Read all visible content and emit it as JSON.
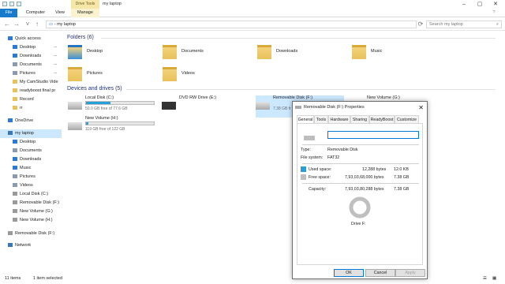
{
  "window": {
    "title": "my laptop",
    "contextual_tab": "Drive Tools"
  },
  "ribbon": {
    "tabs": [
      "File",
      "Computer",
      "View",
      "Manage"
    ]
  },
  "address": {
    "path": "my laptop",
    "search_placeholder": "Search my laptop"
  },
  "nav": {
    "items": [
      {
        "label": "Quick access",
        "icon": "star-icon"
      },
      {
        "label": "Desktop",
        "icon": "desktop-icon"
      },
      {
        "label": "Downloads",
        "icon": "download-icon"
      },
      {
        "label": "Documents",
        "icon": "documents-icon"
      },
      {
        "label": "Pictures",
        "icon": "pictures-icon"
      },
      {
        "label": "My CamStudio Vide",
        "icon": "folder-icon"
      },
      {
        "label": "readyboost final pr",
        "icon": "folder-icon"
      },
      {
        "label": "Record",
        "icon": "folder-icon"
      },
      {
        "label": "rr",
        "icon": "folder-icon"
      },
      {
        "label": "OneDrive",
        "icon": "cloud-icon"
      },
      {
        "label": "my laptop",
        "icon": "computer-icon"
      },
      {
        "label": "Desktop",
        "icon": "desktop-icon"
      },
      {
        "label": "Documents",
        "icon": "documents-icon"
      },
      {
        "label": "Downloads",
        "icon": "download-icon"
      },
      {
        "label": "Music",
        "icon": "music-icon"
      },
      {
        "label": "Pictures",
        "icon": "pictures-icon"
      },
      {
        "label": "Videos",
        "icon": "videos-icon"
      },
      {
        "label": "Local Disk (C:)",
        "icon": "drive-icon"
      },
      {
        "label": "Removable Disk (F:)",
        "icon": "usb-drive-icon"
      },
      {
        "label": "New Volume (G:)",
        "icon": "drive-icon"
      },
      {
        "label": "New Volume (H:)",
        "icon": "drive-icon"
      },
      {
        "label": "Removable Disk (F:)",
        "icon": "usb-drive-icon"
      },
      {
        "label": "Network",
        "icon": "network-icon"
      }
    ]
  },
  "folders": {
    "header": "Folders (6)",
    "items": [
      {
        "label": "Desktop",
        "icon": "desktop-folder-icon"
      },
      {
        "label": "Documents",
        "icon": "documents-folder-icon"
      },
      {
        "label": "Downloads",
        "icon": "downloads-folder-icon"
      },
      {
        "label": "Music",
        "icon": "music-folder-icon"
      },
      {
        "label": "Pictures",
        "icon": "pictures-folder-icon"
      },
      {
        "label": "Videos",
        "icon": "videos-folder-icon"
      }
    ]
  },
  "drives": {
    "header": "Devices and drives (5)",
    "items": [
      {
        "name": "Local Disk (C:)",
        "free": "50.0 GB free of 77.6 GB",
        "used_fraction": 0.36
      },
      {
        "name": "DVD RW Drive (E:)",
        "free": "",
        "used_fraction": null
      },
      {
        "name": "Removable Disk (F:)",
        "free": "7.38 GB fr",
        "used_fraction": null
      },
      {
        "name": "New Volume (G:)",
        "free": "",
        "used_fraction": null
      },
      {
        "name": "New Volume (H:)",
        "free": "119 GB free of 122 GB",
        "used_fraction": 0.03
      }
    ]
  },
  "status": {
    "items_count": "11 items",
    "selected": "1 item selected"
  },
  "dialog": {
    "title": "Removable Disk (F:) Properties",
    "tabs": [
      "General",
      "Tools",
      "Hardware",
      "Sharing",
      "ReadyBoost",
      "Customize"
    ],
    "name_value": "",
    "type_label": "Type:",
    "type_value": "Removable Disk",
    "fs_label": "File system:",
    "fs_value": "FAT32",
    "used_label": "Used space:",
    "used_bytes": "12,288 bytes",
    "used_human": "12.0 KB",
    "free_label": "Free space:",
    "free_bytes": "7,93,03,68,000 bytes",
    "free_human": "7.38 GB",
    "cap_label": "Capacity:",
    "cap_bytes": "7,93,03,80,288 bytes",
    "cap_human": "7.38 GB",
    "drive_label": "Drive F:",
    "buttons": {
      "ok": "OK",
      "cancel": "Cancel",
      "apply": "Apply"
    },
    "colors": {
      "used": "#26a0da",
      "free": "#bfbfbf"
    }
  }
}
